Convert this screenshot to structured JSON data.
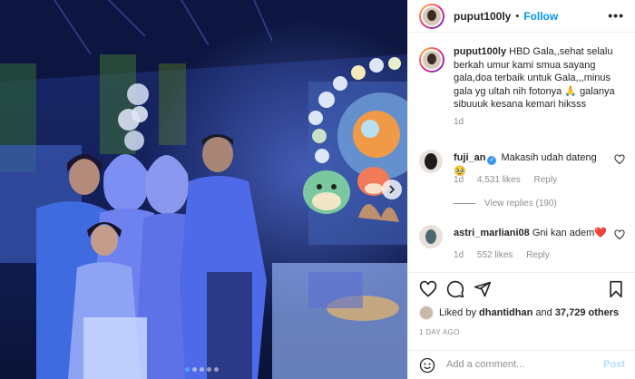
{
  "post": {
    "author": "puput100ly",
    "follow_label": "Follow",
    "separator": "•",
    "more_icon": "ellipsis-icon",
    "caption": {
      "username": "puput100ly",
      "text": "HBD Gala,,sehat selalu berkah umur kami smua sayang gala,doa terbaik untuk Gala,,,minus gala yg ultah nih fotonya 🙏 galanya sibuuuk kesana kemari hiksss",
      "time": "1d"
    },
    "comments": [
      {
        "username": "fuji_an",
        "verified": true,
        "text": "Makasih udah dateng🥹",
        "time": "1d",
        "likes": "4,531 likes",
        "reply_label": "Reply"
      },
      {
        "username": "astri_marliani08",
        "verified": false,
        "text": "Gni kan adem❤️",
        "time": "1d",
        "likes": "552 likes",
        "reply_label": "Reply"
      }
    ],
    "view_replies": "View replies (190)",
    "liked_by": {
      "prefix": "Liked by",
      "user": "dhantidhan",
      "connector": "and",
      "others": "37,729 others"
    },
    "time_ago": "1 DAY AGO",
    "add_comment": {
      "placeholder": "Add a comment...",
      "post_label": "Post"
    },
    "carousel": {
      "count": 5,
      "active_index": 0
    },
    "colors": {
      "accent": "#0095f6",
      "muted": "#8e8e8e",
      "heart": "#ed4956"
    }
  }
}
